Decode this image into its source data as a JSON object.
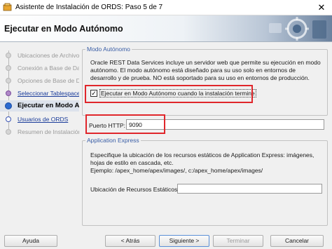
{
  "window": {
    "title": "Asistente de Instalación de ORDS: Paso 5 de 7",
    "close_label": "✕"
  },
  "banner": {
    "heading": "Ejecutar en Modo Autónomo"
  },
  "nav": {
    "items": [
      {
        "label": "Ubicaciones de Archivo de"
      },
      {
        "label": "Conexión a Base de Dat"
      },
      {
        "label": "Opciones de Base de Da"
      },
      {
        "label": "Seleccionar Tablespaces"
      },
      {
        "label": "Ejecutar en Modo Au"
      },
      {
        "label": "Usuarios de ORDS"
      },
      {
        "label": "Resumen de Instalación"
      }
    ]
  },
  "standalone": {
    "legend": "Modo Autónomo",
    "description": "Oracle REST Data Services incluye un servidor web que permite su ejecución en modo autónomo. El modo autónomo está diseñado para su uso solo en entornos de desarrollo y de prueba. NO está soportado para su uso en entornos de producción.",
    "checkbox_label": "Ejecutar en Modo Autónomo cuando la instalación termine",
    "checkbox_mark": "✓",
    "port_label": "Puerto HTTP:",
    "port_value": "9090"
  },
  "apex": {
    "legend": "Application Express",
    "description": "Especifique la ubicación de los recursos estáticos de Application Express: imágenes, hojas de estilo en cascada, etc.",
    "example": "Ejemplo: /apex_home/apex/images/, c:/apex_home/apex/images/",
    "static_label": "Ubicación de Recursos Estáticos:",
    "static_value": ""
  },
  "footer": {
    "help": "Ayuda",
    "back": "< Atrás",
    "next": "Siguiente >",
    "finish": "Terminar",
    "cancel": "Cancelar"
  },
  "colors": {
    "highlight": "#e0262b",
    "link": "#1a3c9a",
    "legend": "#3a5ea6"
  }
}
